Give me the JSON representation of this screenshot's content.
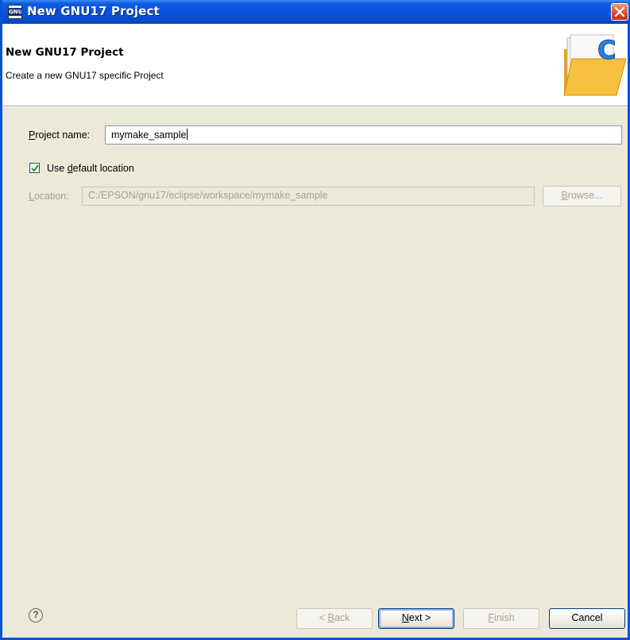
{
  "window": {
    "title": "New GNU17 Project",
    "icon_text": "GNU"
  },
  "header": {
    "title": "New GNU17 Project",
    "subtitle": "Create a new GNU17 specific Project",
    "image_letter": "C"
  },
  "form": {
    "project_name_label_prefix": "P",
    "project_name_label_rest": "roject name:",
    "project_name_value": "mymake_sample",
    "use_default_prefix": "Use ",
    "use_default_mnemonic": "d",
    "use_default_rest": "efault location",
    "use_default_checked": true,
    "location_label_prefix": "L",
    "location_label_rest": "ocation:",
    "location_value": "C:/EPSON/gnu17/eclipse/workspace/mymake_sample",
    "browse_prefix": "B",
    "browse_rest": "rowse..."
  },
  "footer": {
    "help_icon": "help-icon",
    "back_prefix": "< ",
    "back_mnemonic": "B",
    "back_rest": "ack",
    "next_mnemonic": "N",
    "next_rest": "ext >",
    "finish_mnemonic": "F",
    "finish_rest": "inish",
    "cancel_label": "Cancel"
  },
  "colors": {
    "title_bar": "#0a52d4",
    "dialog_bg": "#ece9d8",
    "header_bg": "#ffffff"
  }
}
